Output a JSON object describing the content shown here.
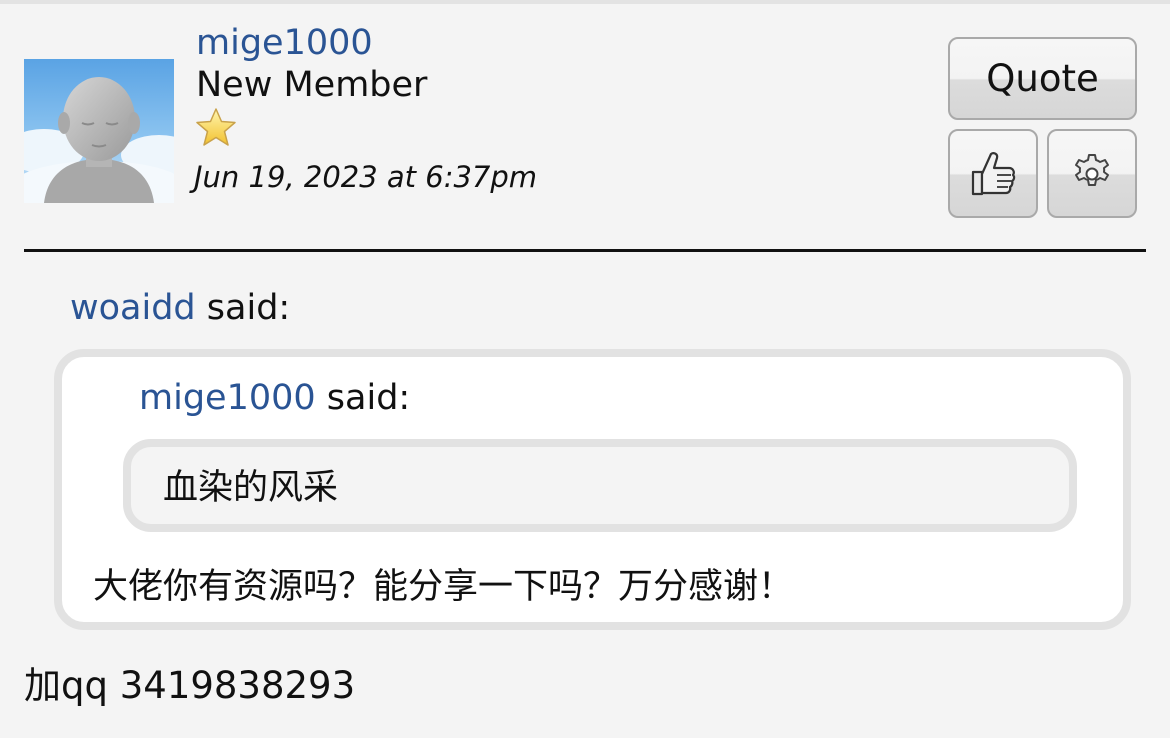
{
  "post": {
    "author": "mige1000",
    "rank": "New Member",
    "rank_icon": "star-icon",
    "date": "Jun 19, 2023 at 6:37pm",
    "body": "加qq 3419838293"
  },
  "actions": {
    "quote_label": "Quote",
    "like_icon": "thumbs-up-icon",
    "options_icon": "gear-icon"
  },
  "quote": {
    "author": "woaidd",
    "said": "said:",
    "nested": {
      "author": "mige1000",
      "said": "said:",
      "text": "血染的风采"
    },
    "reply": "大佬你有资源吗？能分享一下吗？万分感谢！"
  },
  "colors": {
    "link": "#2a5494",
    "background": "#f4f4f4",
    "quote_border": "#e2e2e2"
  }
}
